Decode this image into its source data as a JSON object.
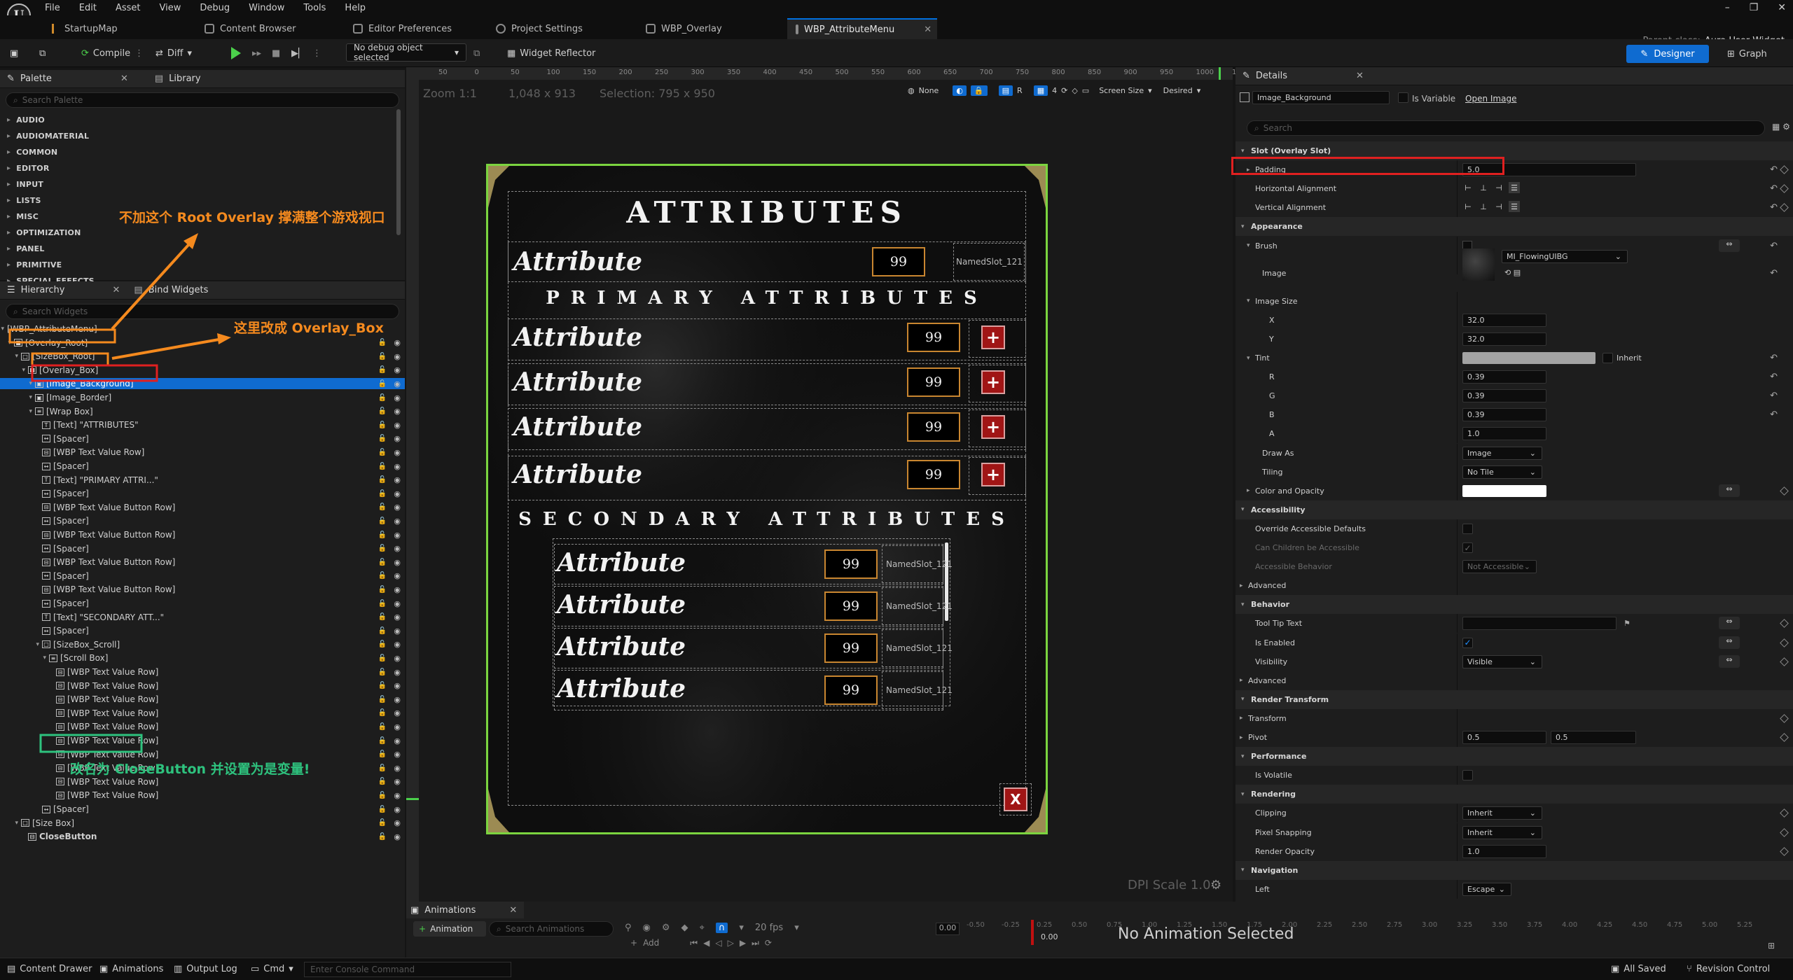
{
  "menu": {
    "items": [
      "File",
      "Edit",
      "Asset",
      "View",
      "Debug",
      "Window",
      "Tools",
      "Help"
    ]
  },
  "tabs": [
    {
      "label": "StartupMap"
    },
    {
      "label": "Content Browser"
    },
    {
      "label": "Editor Preferences"
    },
    {
      "label": "Project Settings"
    },
    {
      "label": "WBP_Overlay"
    },
    {
      "label": "WBP_AttributeMenu",
      "active": true
    }
  ],
  "parent_class": {
    "label": "Parent class:",
    "value": "Aura User Widget"
  },
  "toolbar": {
    "compile": "Compile",
    "diff": "Diff",
    "debug_object": "No debug object selected",
    "widget_reflector": "Widget Reflector",
    "designer": "Designer",
    "graph": "Graph"
  },
  "palette": {
    "title": "Palette",
    "library_tab": "Library",
    "search_placeholder": "Search Palette",
    "categories": [
      "AUDIO",
      "AUDIOMATERIAL",
      "COMMON",
      "EDITOR",
      "INPUT",
      "LISTS",
      "MISC",
      "OPTIMIZATION",
      "PANEL",
      "PRIMITIVE",
      "SPECIAL EFFECTS"
    ]
  },
  "hierarchy": {
    "title": "Hierarchy",
    "bind_tab": "Bind Widgets",
    "search_placeholder": "Search Widgets",
    "rows": [
      {
        "label": "[WBP_AttributeMenu]",
        "indent": 0,
        "glyph": ""
      },
      {
        "label": "[Overlay_Root]",
        "indent": 1,
        "glyph": "■"
      },
      {
        "label": "[SizeBox_Root]",
        "indent": 2,
        "glyph": "□"
      },
      {
        "label": "[Overlay_Box]",
        "indent": 3,
        "glyph": "■"
      },
      {
        "label": "[Image_Background]",
        "indent": 4,
        "glyph": "▣",
        "selected": true
      },
      {
        "label": "[Image_Border]",
        "indent": 4,
        "glyph": "▣"
      },
      {
        "label": "[Wrap Box]",
        "indent": 4,
        "glyph": "≡"
      },
      {
        "label": "[Text] \"ATTRIBUTES\"",
        "indent": 5,
        "glyph": "T"
      },
      {
        "label": "[Spacer]",
        "indent": 5,
        "glyph": "↔"
      },
      {
        "label": "[WBP Text Value Row]",
        "indent": 5,
        "glyph": "⊟"
      },
      {
        "label": "[Spacer]",
        "indent": 5,
        "glyph": "↔"
      },
      {
        "label": "[Text] \"PRIMARY ATTRI...\"",
        "indent": 5,
        "glyph": "T"
      },
      {
        "label": "[Spacer]",
        "indent": 5,
        "glyph": "↔"
      },
      {
        "label": "[WBP Text Value Button Row]",
        "indent": 5,
        "glyph": "⊟"
      },
      {
        "label": "[Spacer]",
        "indent": 5,
        "glyph": "↔"
      },
      {
        "label": "[WBP Text Value Button Row]",
        "indent": 5,
        "glyph": "⊟"
      },
      {
        "label": "[Spacer]",
        "indent": 5,
        "glyph": "↔"
      },
      {
        "label": "[WBP Text Value Button Row]",
        "indent": 5,
        "glyph": "⊟"
      },
      {
        "label": "[Spacer]",
        "indent": 5,
        "glyph": "↔"
      },
      {
        "label": "[WBP Text Value Button Row]",
        "indent": 5,
        "glyph": "⊟"
      },
      {
        "label": "[Spacer]",
        "indent": 5,
        "glyph": "↔"
      },
      {
        "label": "[Text] \"SECONDARY ATT...\"",
        "indent": 5,
        "glyph": "T"
      },
      {
        "label": "[Spacer]",
        "indent": 5,
        "glyph": "↔"
      },
      {
        "label": "[SizeBox_Scroll]",
        "indent": 5,
        "glyph": "□"
      },
      {
        "label": "[Scroll Box]",
        "indent": 6,
        "glyph": "≡"
      },
      {
        "label": "[WBP Text Value Row]",
        "indent": 7,
        "glyph": "⊟"
      },
      {
        "label": "[WBP Text Value Row]",
        "indent": 7,
        "glyph": "⊟"
      },
      {
        "label": "[WBP Text Value Row]",
        "indent": 7,
        "glyph": "⊟"
      },
      {
        "label": "[WBP Text Value Row]",
        "indent": 7,
        "glyph": "⊟"
      },
      {
        "label": "[WBP Text Value Row]",
        "indent": 7,
        "glyph": "⊟"
      },
      {
        "label": "[WBP Text Value Row]",
        "indent": 7,
        "glyph": "⊟"
      },
      {
        "label": "[WBP Text Value Row]",
        "indent": 7,
        "glyph": "⊟"
      },
      {
        "label": "[WBP Text Value Row]",
        "indent": 7,
        "glyph": "⊟"
      },
      {
        "label": "[WBP Text Value Row]",
        "indent": 7,
        "glyph": "⊟"
      },
      {
        "label": "[WBP Text Value Row]",
        "indent": 7,
        "glyph": "⊟"
      },
      {
        "label": "[Spacer]",
        "indent": 5,
        "glyph": "↔"
      },
      {
        "label": "[Size Box]",
        "indent": 2,
        "glyph": "□"
      },
      {
        "label": "CloseButton",
        "indent": 3,
        "glyph": "⊟"
      }
    ]
  },
  "annotations": {
    "root_overlay": "不加这个 Root Overlay 撑满整个游戏视口",
    "overlay_box": "这里改成 Overlay_Box",
    "close_button": "改名为 CloseButton 并设置为是变量!"
  },
  "viewport": {
    "zoom": "Zoom 1:1",
    "size": "1,048 x 913",
    "selection": "Selection: 795 x 950",
    "dpi": "DPI Scale 1.0",
    "none": "None",
    "r": "R",
    "grid": "4",
    "screen_size": "Screen Size",
    "desired": "Desired",
    "ruler_ticks": [
      "50",
      "0",
      "50",
      "100",
      "150",
      "200",
      "250",
      "300",
      "350",
      "400",
      "450",
      "500",
      "550",
      "600",
      "650",
      "700",
      "750",
      "800",
      "850",
      "900",
      "950",
      "1000",
      "1050"
    ]
  },
  "menu_widget": {
    "title": "ATTRIBUTES",
    "top_row": {
      "label": "Attribute",
      "value": "99",
      "slot": "NamedSlot_121"
    },
    "primary_title": "PRIMARY ATTRIBUTES",
    "primary_rows": [
      {
        "label": "Attribute",
        "value": "99",
        "button": "+"
      },
      {
        "label": "Attribute",
        "value": "99",
        "button": "+"
      },
      {
        "label": "Attribute",
        "value": "99",
        "button": "+"
      },
      {
        "label": "Attribute",
        "value": "99",
        "button": "+"
      }
    ],
    "secondary_title": "SECONDARY ATTRIBUTES",
    "secondary_rows": [
      {
        "label": "Attribute",
        "value": "99",
        "slot": "NamedSlot_121"
      },
      {
        "label": "Attribute",
        "value": "99",
        "slot": "NamedSlot_121"
      },
      {
        "label": "Attribute",
        "value": "99",
        "slot": "NamedSlot_121"
      },
      {
        "label": "Attribute",
        "value": "99",
        "slot": "NamedSlot_121"
      }
    ],
    "close": "X"
  },
  "details": {
    "title": "Details",
    "widget_name": "Image_Background",
    "is_variable": "Is Variable",
    "open_image": "Open Image",
    "search_placeholder": "Search",
    "slot_section": "Slot (Overlay Slot)",
    "padding_label": "Padding",
    "padding_value": "5.0",
    "h_align": "Horizontal Alignment",
    "v_align": "Vertical Alignment",
    "appearance": "Appearance",
    "brush": "Brush",
    "image": "Image",
    "image_value": "MI_FlowingUIBG",
    "image_size": "Image Size",
    "x": "X",
    "x_value": "32.0",
    "y": "Y",
    "y_value": "32.0",
    "tint": "Tint",
    "inherit": "Inherit",
    "r": "R",
    "r_value": "0.39",
    "g": "G",
    "g_value": "0.39",
    "b": "B",
    "b_value": "0.39",
    "a": "A",
    "a_value": "1.0",
    "draw_as": "Draw As",
    "draw_as_value": "Image",
    "tiling": "Tiling",
    "tiling_value": "No Tile",
    "color_opacity": "Color and Opacity",
    "accessibility": "Accessibility",
    "override_acc": "Override Accessible Defaults",
    "children_acc": "Can Children be Accessible",
    "acc_behavior": "Accessible Behavior",
    "acc_behavior_value": "Not Accessible",
    "advanced": "Advanced",
    "behavior": "Behavior",
    "tooltip": "Tool Tip Text",
    "is_enabled": "Is Enabled",
    "visibility": "Visibility",
    "visibility_value": "Visible",
    "render_transform": "Render Transform",
    "transform": "Transform",
    "pivot": "Pivot",
    "pivot_x": "0.5",
    "pivot_y": "0.5",
    "performance": "Performance",
    "is_volatile": "Is Volatile",
    "rendering": "Rendering",
    "clipping": "Clipping",
    "clipping_value": "Inherit",
    "pixel_snapping": "Pixel Snapping",
    "pixel_snapping_value": "Inherit",
    "render_opacity": "Render Opacity",
    "render_opacity_value": "1.0",
    "navigation": "Navigation",
    "left": "Left",
    "left_value": "Escape"
  },
  "animations": {
    "title": "Animations",
    "add_btn": "Animation",
    "search_placeholder": "Search Animations",
    "fps": "20 fps",
    "none_selected": "No Animation Selected",
    "add": "Add",
    "time": "0.00",
    "cursor_time": "0.00",
    "ticks": [
      "-0.50",
      "-0.25",
      "0.25",
      "0.50",
      "0.75",
      "1.00",
      "1.25",
      "1.50",
      "1.75",
      "2.00",
      "2.25",
      "2.50",
      "2.75",
      "3.00",
      "3.25",
      "3.50",
      "3.75",
      "4.00",
      "4.25",
      "4.50",
      "4.75",
      "5.00",
      "5.25"
    ]
  },
  "statusbar": {
    "content_drawer": "Content Drawer",
    "animations": "Animations",
    "output_log": "Output Log",
    "cmd": "Cmd",
    "console_placeholder": "Enter Console Command",
    "saved": "All Saved",
    "revision": "Revision Control"
  }
}
